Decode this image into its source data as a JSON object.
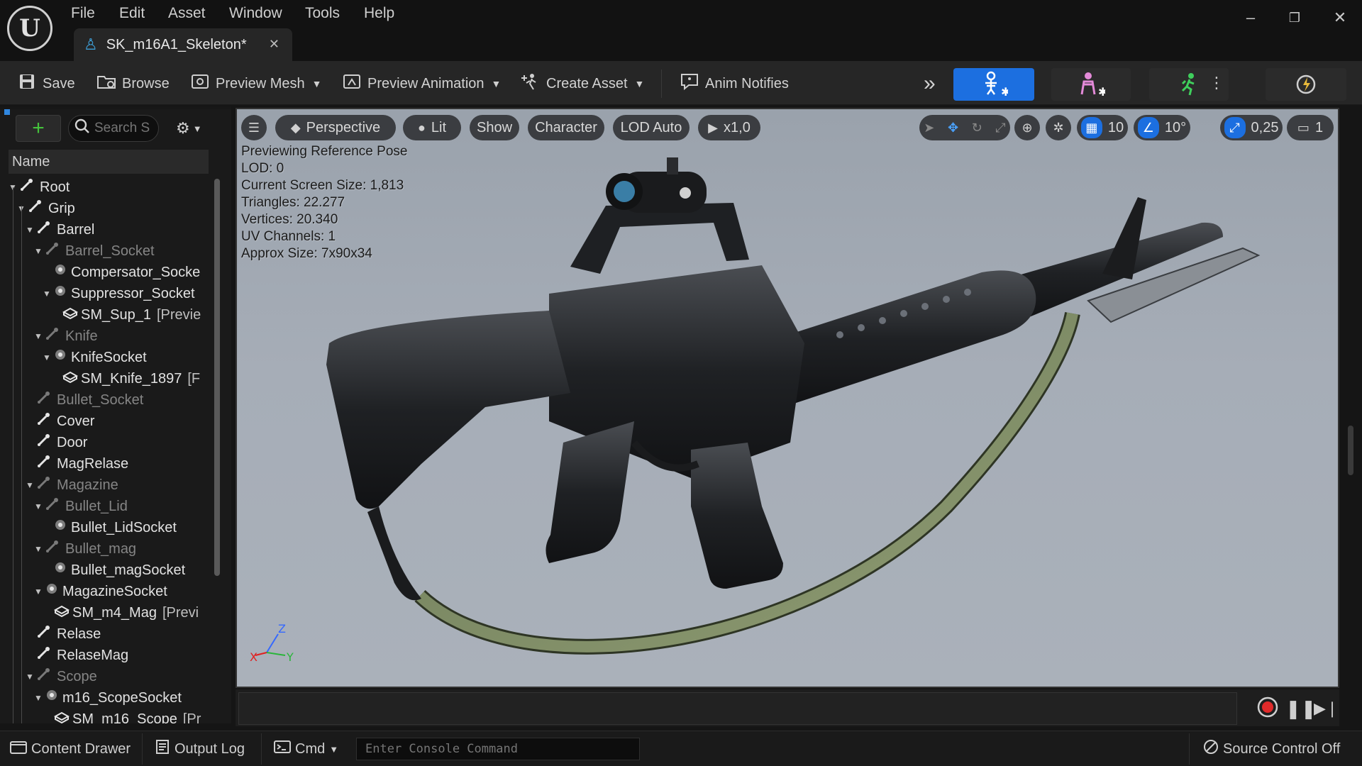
{
  "app": {
    "logo_text": "U",
    "menu": [
      "File",
      "Edit",
      "Asset",
      "Window",
      "Tools",
      "Help"
    ],
    "document_tab": "SK_m16A1_Skeleton*",
    "window_controls": [
      "–",
      "❐",
      "✕"
    ]
  },
  "toolbar": {
    "save": "Save",
    "browse": "Browse",
    "preview_mesh": "Preview Mesh",
    "preview_animation": "Preview Animation",
    "create_asset": "Create Asset",
    "anim_notifies": "Anim Notifies",
    "overflow": "»",
    "accent_color": "#1c6fe0"
  },
  "skeleton_tree": {
    "search_placeholder": "Search S",
    "column_header": "Name",
    "items": [
      {
        "label": "Root",
        "type": "bone",
        "extra": ""
      },
      {
        "label": "Grip",
        "type": "bone",
        "extra": ""
      },
      {
        "label": "Barrel",
        "type": "bone",
        "extra": ""
      },
      {
        "label": "Barrel_Socket",
        "type": "bone-dim",
        "extra": ""
      },
      {
        "label": "Compersator_Socke",
        "type": "socket",
        "extra": ""
      },
      {
        "label": "Suppressor_Socket",
        "type": "socket",
        "extra": ""
      },
      {
        "label": "SM_Sup_1",
        "type": "mesh",
        "extra": "[Previe"
      },
      {
        "label": "Knife",
        "type": "bone-dim",
        "extra": ""
      },
      {
        "label": "KnifeSocket",
        "type": "socket",
        "extra": ""
      },
      {
        "label": "SM_Knife_1897",
        "type": "mesh",
        "extra": "[F"
      },
      {
        "label": "Bullet_Socket",
        "type": "bone-dim",
        "extra": ""
      },
      {
        "label": "Cover",
        "type": "bone",
        "extra": ""
      },
      {
        "label": "Door",
        "type": "bone",
        "extra": ""
      },
      {
        "label": "MagRelase",
        "type": "bone",
        "extra": ""
      },
      {
        "label": "Magazine",
        "type": "bone-dim",
        "extra": ""
      },
      {
        "label": "Bullet_Lid",
        "type": "bone-dim",
        "extra": ""
      },
      {
        "label": "Bullet_LidSocket",
        "type": "socket",
        "extra": ""
      },
      {
        "label": "Bullet_mag",
        "type": "bone-dim",
        "extra": ""
      },
      {
        "label": "Bullet_magSocket",
        "type": "socket",
        "extra": ""
      },
      {
        "label": "MagazineSocket",
        "type": "socket",
        "extra": ""
      },
      {
        "label": "SM_m4_Mag",
        "type": "mesh",
        "extra": "[Previ"
      },
      {
        "label": "Relase",
        "type": "bone",
        "extra": ""
      },
      {
        "label": "RelaseMag",
        "type": "bone",
        "extra": ""
      },
      {
        "label": "Scope",
        "type": "bone-dim",
        "extra": ""
      },
      {
        "label": "m16_ScopeSocket",
        "type": "socket",
        "extra": ""
      },
      {
        "label": "SM_m16_Scope",
        "type": "mesh",
        "extra": "[Pr"
      }
    ]
  },
  "viewport": {
    "toolbar": {
      "perspective": "Perspective",
      "lit": "Lit",
      "show": "Show",
      "character": "Character",
      "lod": "LOD Auto",
      "play_speed": "x1,0",
      "grid_snap": "10",
      "rotation_snap": "10°",
      "scale_snap": "0,25",
      "camera_speed": "1"
    },
    "stats": [
      "Previewing Reference Pose",
      "LOD: 0",
      "Current Screen Size: 1,813",
      "Triangles: 22.277",
      "Vertices: 20.340",
      "UV Channels: 1",
      "Approx Size: 7x90x34"
    ],
    "axis": {
      "x": "X",
      "y": "Y",
      "z": "Z"
    }
  },
  "statusbar": {
    "content_drawer": "Content Drawer",
    "output_log": "Output Log",
    "cmd": "Cmd",
    "console_placeholder": "Enter Console Command",
    "source_control": "Source Control Off"
  }
}
